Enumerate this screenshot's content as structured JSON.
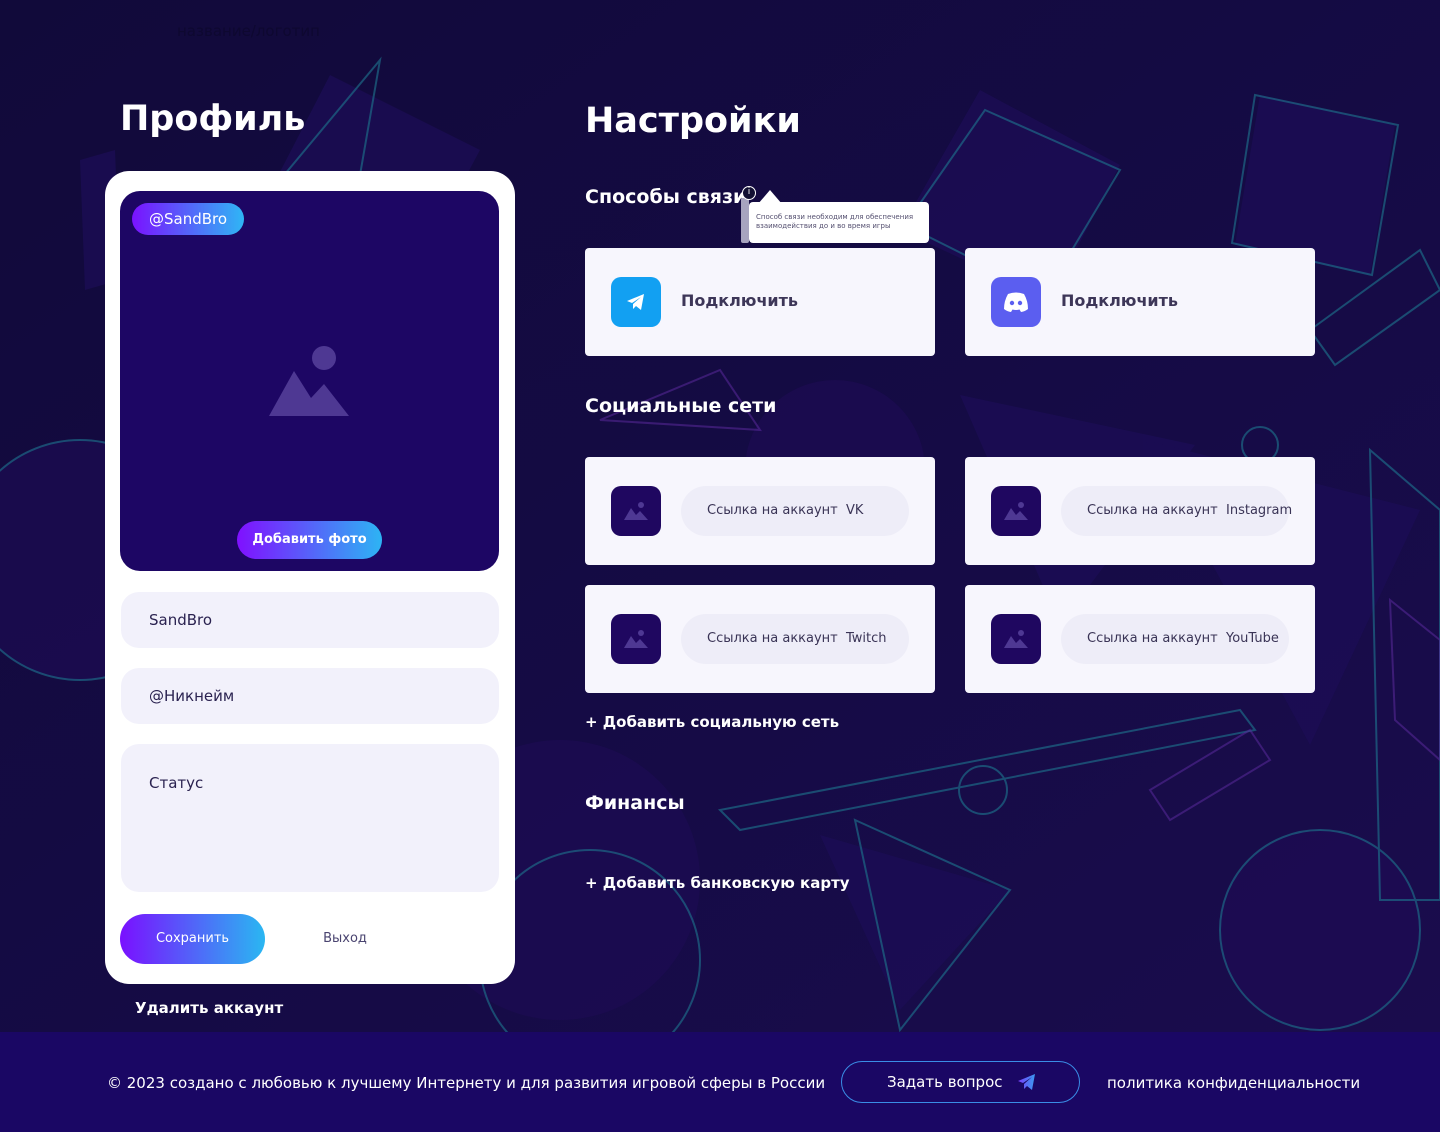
{
  "header": {
    "logo_text": "название/логотип"
  },
  "profile": {
    "title": "Профиль",
    "handle_badge": "@SandBro",
    "add_photo_label": "Добавить фото",
    "name_value": "SandBro",
    "nickname_placeholder": "@Никнейм",
    "status_placeholder": "Статус",
    "save_label": "Сохранить",
    "exit_label": "Выход",
    "delete_label": "Удалить аккаунт"
  },
  "settings": {
    "title": "Настройки",
    "contacts": {
      "title": "Способы связи",
      "info_glyph": "i",
      "tooltip": "Способ связи необходим для обеспечения взаимодействия до и во время игры",
      "items": [
        {
          "service_icon": "telegram-icon",
          "label": "Подключить"
        },
        {
          "service_icon": "discord-icon",
          "label": "Подключить"
        }
      ]
    },
    "social": {
      "title": "Социальные сети",
      "items": [
        {
          "label": "Ссылка на аккаунт  VK"
        },
        {
          "label": "Ссылка на аккаунт  Instagram"
        },
        {
          "label": "Ссылка на аккаунт  Twitch"
        },
        {
          "label": "Ссылка на аккаунт  YouTube"
        }
      ],
      "add_label": "+ Добавить социальную сеть"
    },
    "finance": {
      "title": "Финансы",
      "add_card_label": "+ Добавить банковскую карту"
    }
  },
  "footer": {
    "copyright": "© 2023 создано с любовью к лучшему Интернету и для развития игровой сферы в России",
    "ask_label": "Задать вопрос",
    "privacy_label": "политика конфиденциальности"
  },
  "colors": {
    "background": "#0f0833",
    "footer": "#1a0764",
    "photo_bg": "#1d0664",
    "accent_gradient_start": "#7a12ff",
    "accent_gradient_end": "#2fb6f5",
    "telegram": "#12a0f2",
    "discord": "#5b5ef0"
  }
}
